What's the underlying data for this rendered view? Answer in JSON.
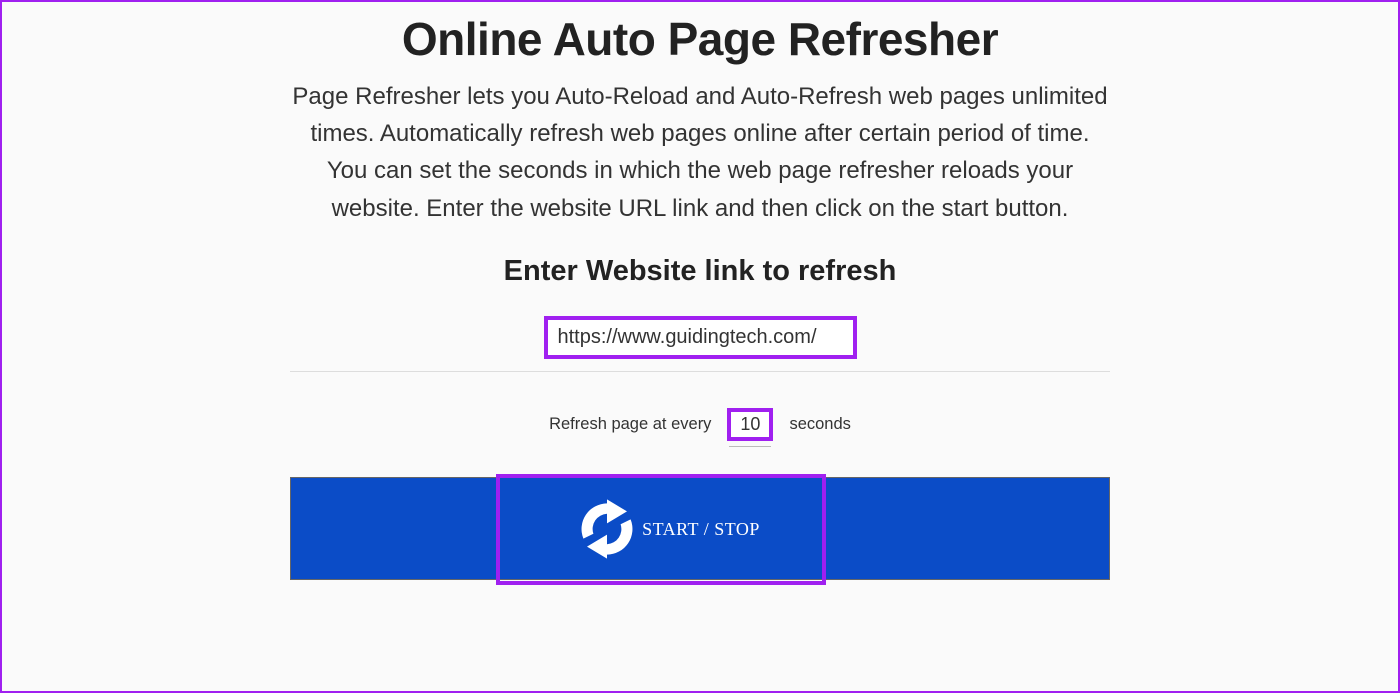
{
  "header": {
    "title": "Online Auto Page Refresher",
    "description": "Page Refresher lets you Auto-Reload and Auto-Refresh web pages unlimited times. Automatically refresh web pages online after certain period of time. You can set the seconds in which the web page refresher reloads your website. Enter the website URL link and then click on the start button."
  },
  "form": {
    "subtitle": "Enter Website link to refresh",
    "url_value": "https://www.guidingtech.com/",
    "interval_prefix": "Refresh page at every",
    "interval_value": "10",
    "interval_suffix": "seconds",
    "button_label": "START / STOP"
  },
  "colors": {
    "highlight": "#a020f0",
    "button_bg": "#0b4cc7"
  }
}
